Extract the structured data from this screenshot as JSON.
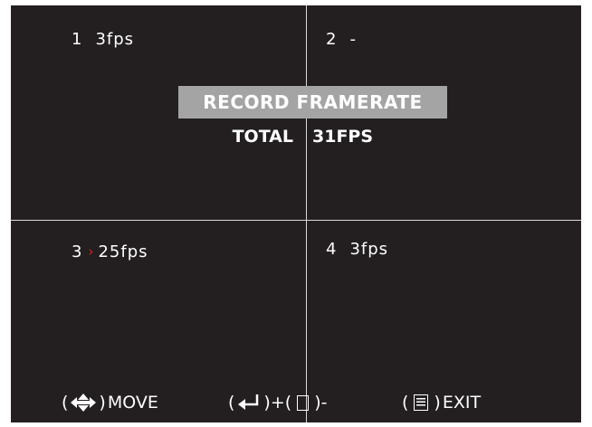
{
  "channels": [
    {
      "num": "1",
      "value": "3fps",
      "selected": false
    },
    {
      "num": "2",
      "value": "-",
      "selected": false
    },
    {
      "num": "3",
      "value": "25fps",
      "selected": true,
      "cursor": "›"
    },
    {
      "num": "4",
      "value": "3fps",
      "selected": false
    }
  ],
  "dialog": {
    "title": "RECORD FRAMERATE",
    "total_label": "TOTAL",
    "total_value": "31FPS"
  },
  "help": {
    "move_label": "MOVE",
    "plus_label": "+",
    "minus_label": "-",
    "exit_label": "EXIT",
    "open_paren": "(",
    "close_paren": ")",
    "icons": {
      "move": "four-way-arrow-icon",
      "increase": "enter-arrow-icon",
      "decrease": "square-button-icon",
      "exit": "menu-list-icon"
    }
  },
  "colors": {
    "background": "#231f20",
    "grid_line": "#d9d9d9",
    "title_bar": "#a4a4a4",
    "cursor": "#e01f1f",
    "text": "#ffffff"
  }
}
